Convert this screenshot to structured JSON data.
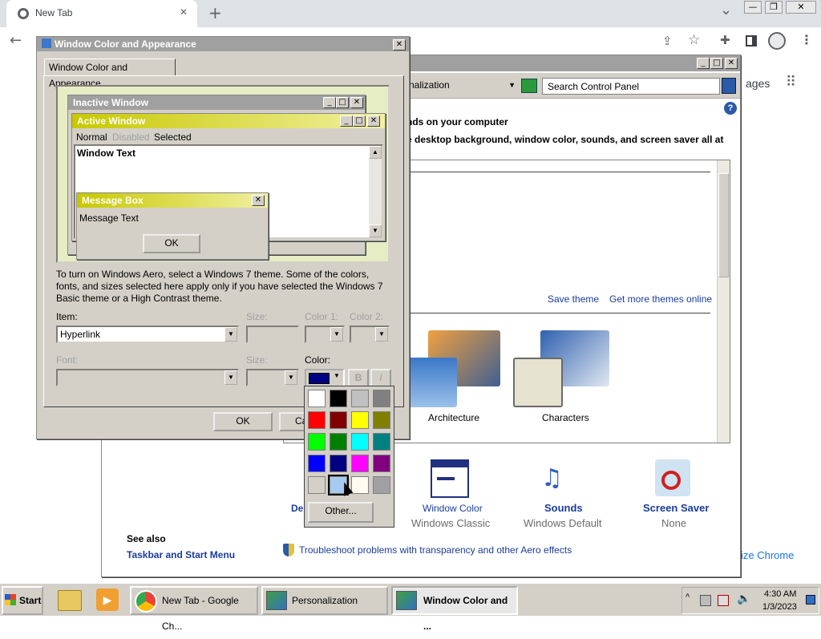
{
  "chrome": {
    "tab_title": "New Tab",
    "tab_close": "✕",
    "new_tab": "+",
    "tab_dropdown": "⌄",
    "behind_text_1": "ages",
    "behind_text_2": "ize Chrome"
  },
  "chrome_window": {
    "minimize": "—",
    "restore": "❐",
    "close": "✕"
  },
  "cp": {
    "breadcrumb": "nalization",
    "search_placeholder": "Search Control Panel",
    "heading": "nds on your computer",
    "subheading": "e desktop background, window color, sounds, and screen saver all at",
    "save_theme": "Save theme",
    "more_themes": "Get more themes online",
    "themes": [
      {
        "label": "Architecture"
      },
      {
        "label": "Characters"
      }
    ],
    "bottom": {
      "desktop_bg": "De",
      "window_color": "Window Color",
      "window_color_sub": "Windows Classic",
      "sounds": "Sounds",
      "sounds_sub": "Windows Default",
      "screen_saver": "Screen Saver",
      "screen_saver_sub": "None"
    },
    "see_also": "See also",
    "taskbar_link": "Taskbar and Start Menu",
    "troubleshoot": "Troubleshoot problems with transparency and other Aero effects"
  },
  "dialog": {
    "title": "Window Color and Appearance",
    "tab": "Window Color and Appearance",
    "preview": {
      "inactive_title": "Inactive Window",
      "active_title": "Active Window",
      "menu_normal": "Normal",
      "menu_disabled": "Disabled",
      "menu_selected": "Selected",
      "window_text": "Window Text",
      "msgbox_title": "Message Box",
      "msgbox_text": "Message Text",
      "msgbox_ok": "OK"
    },
    "info": "To turn on Windows Aero, select a Windows 7 theme.  Some of the colors, fonts, and sizes selected here apply only if you have selected the Windows 7 Basic theme or a High Contrast theme.",
    "item_label": "Item:",
    "item_value": "Hyperlink",
    "size_label": "Size:",
    "color1_label": "Color 1:",
    "color2_label": "Color 2:",
    "font_label": "Font:",
    "size2_label": "Size:",
    "color_label": "Color:",
    "bold": "B",
    "italic": "I",
    "ok": "OK",
    "cancel": "Ca"
  },
  "color_picker": {
    "swatches": [
      "#ffffff",
      "#000000",
      "#c0c0c0",
      "#808080",
      "#ff0000",
      "#800000",
      "#ffff00",
      "#808000",
      "#00ff00",
      "#008000",
      "#00ffff",
      "#008080",
      "#0000ff",
      "#000080",
      "#ff00ff",
      "#800080",
      "#d4d0c8",
      "#a6caf0",
      "#fffbf0",
      "#a0a0a4"
    ],
    "selected_color": "#000080",
    "other": "Other..."
  },
  "taskbar": {
    "start": "Start",
    "tasks": [
      {
        "label": "New Tab - Google Ch..."
      },
      {
        "label": "Personalization"
      },
      {
        "label": "Window Color and ..."
      }
    ],
    "time": "4:30 AM",
    "date": "1/3/2023"
  },
  "colors": {
    "active_title": "#c8c800",
    "inactive_title": "#a0a0a0",
    "link": "#1a3c9c"
  }
}
